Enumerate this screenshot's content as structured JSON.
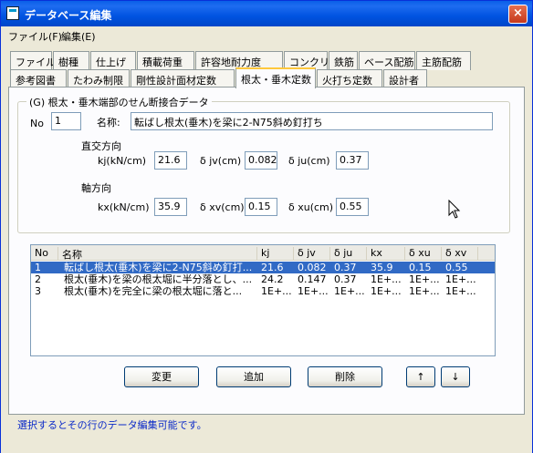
{
  "window": {
    "title": "データベース編集",
    "close": "×"
  },
  "menu": [
    "ファイル(F)",
    "編集(E)"
  ],
  "tabs_row1": [
    "ファイル",
    "樹種",
    "仕上げ",
    "積載荷重",
    "許容地耐力度",
    "コンクリート",
    "鉄筋",
    "ベース配筋",
    "主筋配筋"
  ],
  "tabs_row2": [
    "参考図書",
    "たわみ制限",
    "剛性設計面材定数",
    "根太・垂木定数",
    "火打ち定数",
    "設計者"
  ],
  "group": {
    "title": "(G) 根太・垂木端部のせん断接合データ",
    "no_label": "No",
    "no_value": "1",
    "name_label": "名称:",
    "name_value": "転ばし根太(垂木)を梁に2-N75斜め釘打ち",
    "dir_perp": "直交方向",
    "kj_label": "kj(kN/cm)",
    "kj_value": "21.6",
    "djv_label": "δ jv(cm)",
    "djv_value": "0.082",
    "dju_label": "δ ju(cm)",
    "dju_value": "0.37",
    "dir_axial": "軸方向",
    "kx_label": "kx(kN/cm)",
    "kx_value": "35.9",
    "dxv_label": "δ xv(cm)",
    "dxv_value": "0.15",
    "dxu_label": "δ xu(cm)",
    "dxu_value": "0.55"
  },
  "list": {
    "columns": [
      "No",
      "名称",
      "kj",
      "δ jv",
      "δ ju",
      "kx",
      "δ xu",
      "δ xv"
    ],
    "rows": [
      [
        "1",
        "転ばし根太(垂木)を梁に2-N75斜め釘打...",
        "21.6",
        "0.082",
        "0.37",
        "35.9",
        "0.15",
        "0.55"
      ],
      [
        "2",
        "根太(垂木)を梁の根太堀に半分落とし、...",
        "24.2",
        "0.147",
        "0.37",
        "1E+...",
        "1E+...",
        "1E+..."
      ],
      [
        "3",
        "根太(垂木)を完全に梁の根太堀に落と...",
        "1E+...",
        "1E+...",
        "1E+...",
        "1E+...",
        "1E+...",
        "1E+..."
      ]
    ]
  },
  "buttons": {
    "change": "変更",
    "add": "追加",
    "delete": "削除",
    "up": "↑",
    "down": "↓"
  },
  "status": "選択するとその行のデータ編集可能です。"
}
